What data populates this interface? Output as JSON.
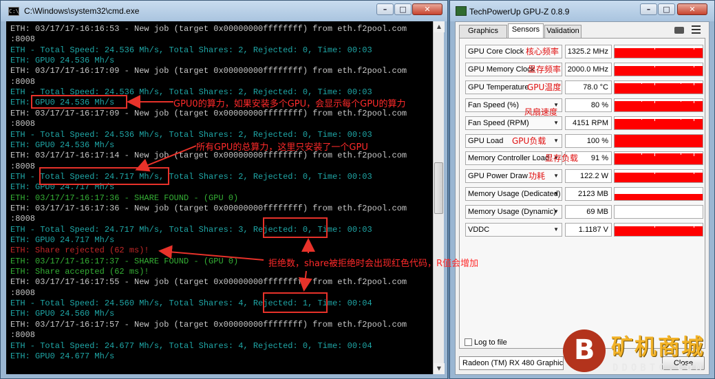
{
  "cmd": {
    "title": "C:\\Windows\\system32\\cmd.exe",
    "lines": [
      {
        "text": "ETH: 03/17/17-16:16:53 - New job (target 0x00000000ffffffff) from eth.f2pool.com",
        "color": "white"
      },
      {
        "text": ":8008",
        "color": "white"
      },
      {
        "text": "ETH - Total Speed: 24.536 Mh/s, Total Shares: 2, Rejected: 0, Time: 00:03",
        "color": "cyan"
      },
      {
        "text": "ETH: GPU0 24.536 Mh/s",
        "color": "cyan"
      },
      {
        "text": "ETH: 03/17/17-16:17:09 - New job (target 0x00000000ffffffff) from eth.f2pool.com",
        "color": "white"
      },
      {
        "text": ":8008",
        "color": "white"
      },
      {
        "text": "ETH - Total Speed: 24.536 Mh/s, Total Shares: 2, Rejected: 0, Time: 00:03",
        "color": "cyan"
      },
      {
        "text": "ETH: GPU0 24.536 Mh/s",
        "color": "cyan"
      },
      {
        "text": "ETH: 03/17/17-16:17:09 - New job (target 0x00000000ffffffff) from eth.f2pool.com",
        "color": "white"
      },
      {
        "text": ":8008",
        "color": "white"
      },
      {
        "text": "ETH - Total Speed: 24.536 Mh/s, Total Shares: 2, Rejected: 0, Time: 00:03",
        "color": "cyan"
      },
      {
        "text": "ETH: GPU0 24.536 Mh/s",
        "color": "cyan"
      },
      {
        "text": "ETH: 03/17/17-16:17:14 - New job (target 0x00000000ffffffff) from eth.f2pool.com",
        "color": "white"
      },
      {
        "text": ":8008",
        "color": "white"
      },
      {
        "text": "ETH - Total Speed: 24.717 Mh/s, Total Shares: 2, Rejected: 0, Time: 00:03",
        "color": "cyan"
      },
      {
        "text": "ETH: GPU0 24.717 Mh/s",
        "color": "cyan"
      },
      {
        "text": "ETH: 03/17/17-16:17:36 - SHARE FOUND - (GPU 0)",
        "color": "green"
      },
      {
        "text": "ETH: 03/17/17-16:17:36 - New job (target 0x00000000ffffffff) from eth.f2pool.com",
        "color": "white"
      },
      {
        "text": ":8008",
        "color": "white"
      },
      {
        "text": "ETH - Total Speed: 24.717 Mh/s, Total Shares: 3, Rejected: 0, Time: 00:03",
        "color": "cyan"
      },
      {
        "text": "ETH: GPU0 24.717 Mh/s",
        "color": "cyan"
      },
      {
        "text": "ETH: Share rejected (62 ms)!",
        "color": "red"
      },
      {
        "text": "ETH: 03/17/17-16:17:37 - SHARE FOUND - (GPU 0)",
        "color": "green"
      },
      {
        "text": "ETH: Share accepted (62 ms)!",
        "color": "green"
      },
      {
        "text": "ETH: 03/17/17-16:17:55 - New job (target 0x00000000ffffffff) from eth.f2pool.com",
        "color": "white"
      },
      {
        "text": ":8008",
        "color": "white"
      },
      {
        "text": "ETH - Total Speed: 24.560 Mh/s, Total Shares: 4, Rejected: 1, Time: 00:04",
        "color": "cyan"
      },
      {
        "text": "ETH: GPU0 24.560 Mh/s",
        "color": "cyan"
      },
      {
        "text": "ETH: 03/17/17-16:17:57 - New job (target 0x00000000ffffffff) from eth.f2pool.com",
        "color": "white"
      },
      {
        "text": ":8008",
        "color": "white"
      },
      {
        "text": "ETH - Total Speed: 24.677 Mh/s, Total Shares: 4, Rejected: 0, Time: 00:04",
        "color": "cyan"
      },
      {
        "text": "ETH: GPU0 24.677 Mh/s",
        "color": "cyan"
      }
    ],
    "buttons": {
      "minimize": "–",
      "maximize": "□",
      "close": "✕"
    }
  },
  "gpuz": {
    "title": "TechPowerUp GPU-Z 0.8.9",
    "tabs": [
      "Graphics Card",
      "Sensors",
      "Validation"
    ],
    "active_tab": "Sensors",
    "sensors": [
      {
        "label": "GPU Core Clock",
        "value": "1325.2 MHz",
        "dropdown": false,
        "level": 0.8,
        "note": "核心频率"
      },
      {
        "label": "GPU Memory Clock",
        "value": "2000.0 MHz",
        "dropdown": false,
        "level": 0.8,
        "note": "显存频率"
      },
      {
        "label": "GPU Temperature",
        "value": "78.0 °C",
        "dropdown": false,
        "level": 0.8,
        "note": "GPU温度"
      },
      {
        "label": "Fan Speed (%)",
        "value": "80 %",
        "dropdown": true,
        "level": 0.8,
        "note": ""
      },
      {
        "label": "Fan Speed (RPM)",
        "value": "4151 RPM",
        "dropdown": true,
        "level": 0.8,
        "note": "风扇速度"
      },
      {
        "label": "GPU Load",
        "value": "100 %",
        "dropdown": true,
        "level": 1.0,
        "note": "GPU负载"
      },
      {
        "label": "Memory Controller Load",
        "value": "91 %",
        "dropdown": true,
        "level": 0.9,
        "note": "显存负载"
      },
      {
        "label": "GPU Power Draw",
        "value": "122.2 W",
        "dropdown": true,
        "level": 0.8,
        "note": "功耗"
      },
      {
        "label": "Memory Usage (Dedicated)",
        "value": "2123 MB",
        "dropdown": true,
        "level": 0.5,
        "note": ""
      },
      {
        "label": "Memory Usage (Dynamic)",
        "value": "69 MB",
        "dropdown": true,
        "level": 0.0,
        "note": ""
      },
      {
        "label": "VDDC",
        "value": "1.1187 V",
        "dropdown": true,
        "level": 0.8,
        "note": ""
      }
    ],
    "log_to_file": "Log to file",
    "card_select": "Radeon (TM) RX 480 Graphics",
    "close_label": "Close",
    "buttons": {
      "minimize": "–",
      "maximize": "□",
      "close": "✕"
    }
  },
  "annotations": {
    "gpu0": "GPU0的算力，如果安装多个GPU，会显示每个GPU的算力",
    "total": "所有GPU的总算力，这里只安装了一个GPU",
    "rejected": "拒绝数，share被拒绝时会出现红色代码，R值会增加",
    "color": "#e8322a"
  },
  "watermark": {
    "title": "矿机商城",
    "subtitle": "DDOBTC.COM"
  }
}
